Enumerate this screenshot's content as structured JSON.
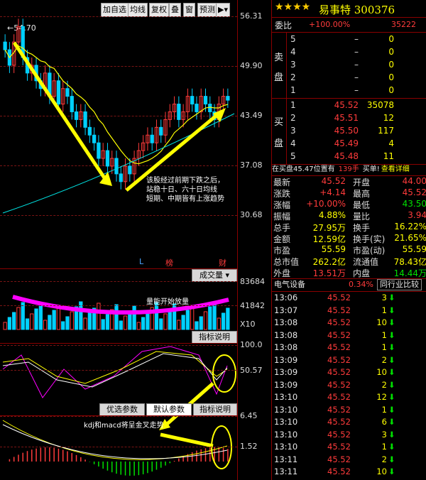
{
  "toolbar": {
    "buttons": [
      "加自选",
      "均线",
      "复权",
      "叠",
      "窗",
      "预测"
    ],
    "menu_icon": "play-menu-icon"
  },
  "price_axis": [
    "56.31",
    "49.90",
    "43.49",
    "37.08",
    "30.68"
  ],
  "high_label": "54.70",
  "annotation_1": "该股经过前期下跌之后，\n站稳十日、六十日均线\n短期、中期皆有上涨趋势",
  "markers": {
    "L": "L",
    "bang": "榜",
    "cai": "财"
  },
  "volume": {
    "dropdown": "成交量",
    "axis": [
      "83684",
      "41842",
      "X10"
    ],
    "note": "量能开始放量",
    "btn": "指标说明"
  },
  "kdj": {
    "axis": [
      "100.0",
      "50.57"
    ],
    "tabs": [
      "优选参数",
      "默认参数",
      "指标说明"
    ]
  },
  "macd": {
    "axis": [
      "6.45",
      "1.52"
    ],
    "note": "kdj和macd将呈金叉走势"
  },
  "quote": {
    "title": "易事特 300376",
    "weibi_label": "委比",
    "weibi_val": "+100.00%",
    "weicha_val": "35222",
    "sell_label": [
      "卖",
      "盘"
    ],
    "buy_label": [
      "买",
      "盘"
    ],
    "sell": [
      [
        "5",
        "–",
        "0"
      ],
      [
        "4",
        "–",
        "0"
      ],
      [
        "3",
        "–",
        "0"
      ],
      [
        "2",
        "–",
        "0"
      ],
      [
        "1",
        "–",
        "0"
      ]
    ],
    "buy": [
      [
        "1",
        "45.52",
        "35078"
      ],
      [
        "2",
        "45.51",
        "12"
      ],
      [
        "3",
        "45.50",
        "117"
      ],
      [
        "4",
        "45.49",
        "4"
      ],
      [
        "5",
        "45.48",
        "11"
      ]
    ],
    "order_bar": [
      "在买盘45.47位置有",
      "139手",
      "买单!",
      "查看详细"
    ],
    "stats": [
      [
        "最新",
        "45.52",
        "开盘",
        "44.00"
      ],
      [
        "涨跌",
        "+4.14",
        "最高",
        "45.52"
      ],
      [
        "涨幅",
        "+10.00%",
        "最低",
        "43.50"
      ],
      [
        "振幅",
        "4.88%",
        "量比",
        "3.94"
      ],
      [
        "总手",
        "27.95万",
        "换手",
        "16.22%"
      ],
      [
        "金额",
        "12.59亿",
        "换手(实)",
        "21.65%"
      ],
      [
        "市盈",
        "55.59",
        "市盈(动)",
        "55.59"
      ],
      [
        "总市值",
        "262.2亿",
        "流通值",
        "78.43亿"
      ],
      [
        "外盘",
        "13.51万",
        "内盘",
        "14.44万"
      ]
    ],
    "industry": "电气设备",
    "industry_pct": "0.34%",
    "compare": "同行业比较",
    "ticks": [
      [
        "13:06",
        "45.52",
        "3"
      ],
      [
        "13:07",
        "45.52",
        "1"
      ],
      [
        "13:08",
        "45.52",
        "10"
      ],
      [
        "13:08",
        "45.52",
        "1"
      ],
      [
        "13:08",
        "45.52",
        "1"
      ],
      [
        "13:09",
        "45.52",
        "2"
      ],
      [
        "13:09",
        "45.52",
        "10"
      ],
      [
        "13:09",
        "45.52",
        "2"
      ],
      [
        "13:10",
        "45.52",
        "12"
      ],
      [
        "13:10",
        "45.52",
        "1"
      ],
      [
        "13:10",
        "45.52",
        "6"
      ],
      [
        "13:10",
        "45.52",
        "3"
      ],
      [
        "13:10",
        "45.52",
        "1"
      ],
      [
        "13:11",
        "45.52",
        "2"
      ],
      [
        "13:11",
        "45.52",
        "10"
      ]
    ]
  }
}
